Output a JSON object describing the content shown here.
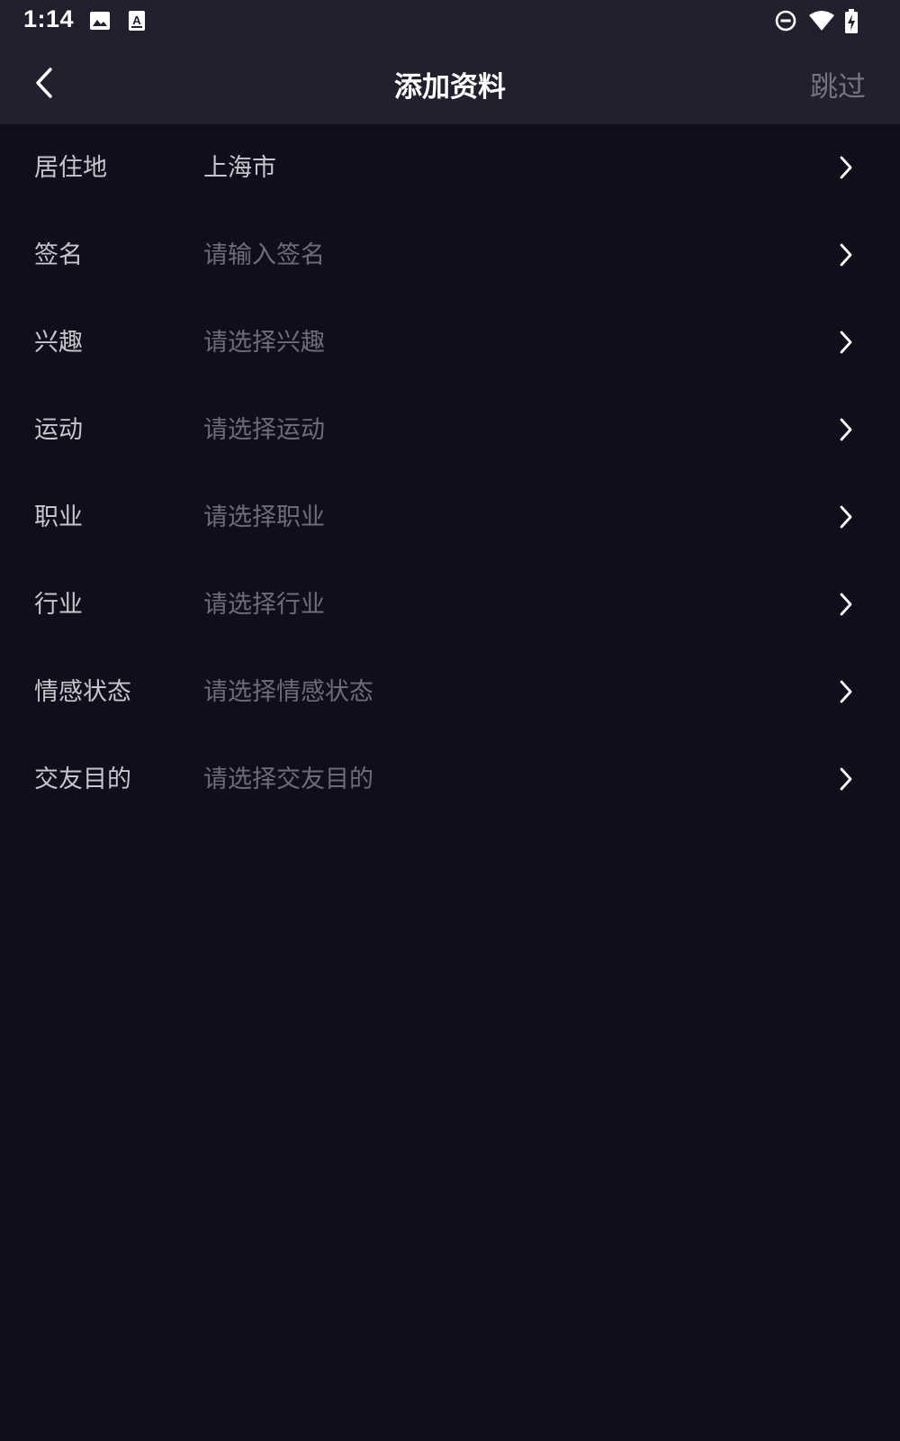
{
  "status_bar": {
    "time": "1:14",
    "icons": [
      "image-icon",
      "a-font-icon",
      "do-not-disturb-icon",
      "wifi-icon",
      "battery-charging-icon"
    ]
  },
  "app_bar": {
    "back_icon": "chevron-left-icon",
    "title": "添加资料",
    "skip_label": "跳过"
  },
  "rows": [
    {
      "label": "居住地",
      "value": "上海市",
      "filled": true
    },
    {
      "label": "签名",
      "value": "请输入签名",
      "filled": false
    },
    {
      "label": "兴趣",
      "value": "请选择兴趣",
      "filled": false
    },
    {
      "label": "运动",
      "value": "请选择运动",
      "filled": false
    },
    {
      "label": "职业",
      "value": "请选择职业",
      "filled": false
    },
    {
      "label": "行业",
      "value": "请选择行业",
      "filled": false
    },
    {
      "label": "情感状态",
      "value": "请选择情感状态",
      "filled": false
    },
    {
      "label": "交友目的",
      "value": "请选择交友目的",
      "filled": false
    }
  ],
  "colors": {
    "background": "#0f0e1a",
    "bar_background": "#21202f",
    "label": "#c7c6cf",
    "placeholder": "#6d6c78",
    "skip": "#75747f"
  }
}
